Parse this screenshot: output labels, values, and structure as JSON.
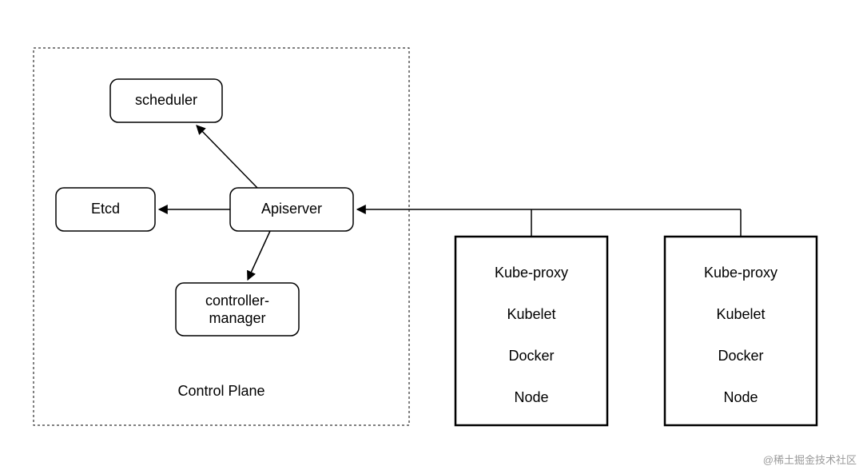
{
  "control_plane": {
    "title": "Control Plane",
    "scheduler": "scheduler",
    "etcd": "Etcd",
    "apiserver": "Apiserver",
    "controller_manager_l1": "controller-",
    "controller_manager_l2": "manager"
  },
  "node1": {
    "kube_proxy": "Kube-proxy",
    "kubelet": "Kubelet",
    "docker": "Docker",
    "node": "Node"
  },
  "node2": {
    "kube_proxy": "Kube-proxy",
    "kubelet": "Kubelet",
    "docker": "Docker",
    "node": "Node"
  },
  "watermark": "@稀土掘金技术社区"
}
